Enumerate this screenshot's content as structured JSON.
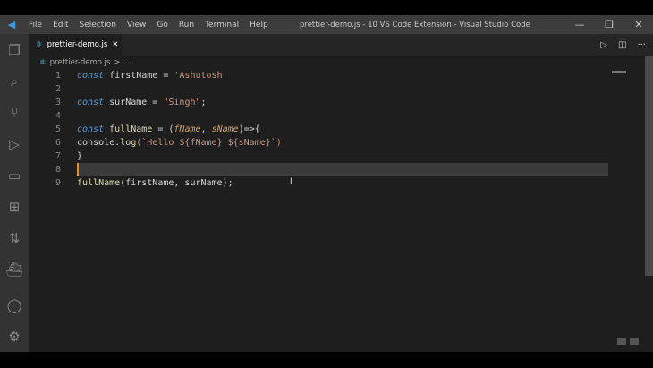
{
  "title": "prettier-demo.js - 10 VS Code Extension - Visual Studio Code",
  "menu": [
    "File",
    "Edit",
    "Selection",
    "View",
    "Go",
    "Run",
    "Terminal",
    "Help"
  ],
  "tab": {
    "label": "prettier-demo.js",
    "close": "✕"
  },
  "breadcrumb": {
    "file": "prettier-demo.js",
    "sep": ">",
    "more": "..."
  },
  "lines": [
    "1",
    "2",
    "3",
    "4",
    "5",
    "6",
    "7",
    "8",
    "9"
  ],
  "code": {
    "l1": [
      "const",
      "firstName = ",
      "'Ashutosh'"
    ],
    "l3": [
      "const",
      "surName = ",
      "\"Singh\"",
      ";"
    ],
    "l5": [
      "const",
      "fullName",
      "= (",
      "fName",
      ", ",
      "sName",
      ")=>{"
    ],
    "l6": [
      "console.",
      "log",
      "(`Hello ${fName} ${sName}`)"
    ],
    "l7": "}",
    "l9": [
      "fullName",
      "(firstName, surName);"
    ]
  }
}
